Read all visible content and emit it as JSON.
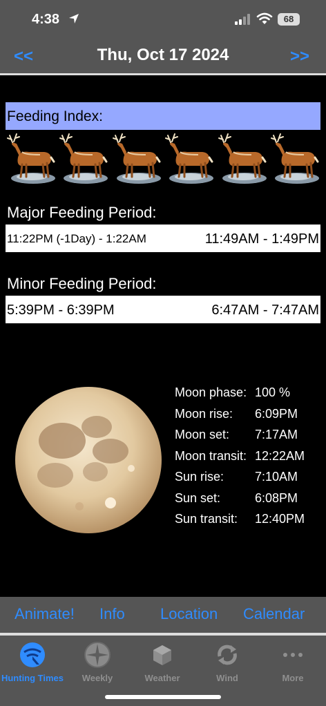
{
  "status_bar": {
    "time": "4:38",
    "battery": "68"
  },
  "header": {
    "prev": "<<",
    "date": "Thu, Oct 17 2024",
    "next": ">>"
  },
  "feeding_index": {
    "label": "Feeding Index:",
    "deer_count": 6
  },
  "major": {
    "label": "Major Feeding Period:",
    "left": "11:22PM (-1Day) - 1:22AM",
    "right": "11:49AM - 1:49PM"
  },
  "minor": {
    "label": "Minor Feeding Period:",
    "left": "5:39PM - 6:39PM",
    "right": "6:47AM - 7:47AM"
  },
  "astro": [
    {
      "key": "Moon phase:",
      "value": "100 %"
    },
    {
      "key": "Moon rise:",
      "value": "6:09PM"
    },
    {
      "key": "Moon set:",
      "value": "7:17AM"
    },
    {
      "key": "Moon transit:",
      "value": "12:22AM"
    },
    {
      "key": "Sun rise:",
      "value": "7:10AM"
    },
    {
      "key": "Sun set:",
      "value": "6:08PM"
    },
    {
      "key": "Sun transit:",
      "value": "12:40PM"
    }
  ],
  "actions": [
    "Animate!",
    "Info",
    "Location",
    "Calendar"
  ],
  "tabs": [
    {
      "label": "Hunting Times",
      "icon": "radar-icon",
      "active": true
    },
    {
      "label": "Weekly",
      "icon": "compass-icon",
      "active": false
    },
    {
      "label": "Weather",
      "icon": "cube-icon",
      "active": false
    },
    {
      "label": "Wind",
      "icon": "wind-icon",
      "active": false
    },
    {
      "label": "More",
      "icon": "more-icon",
      "active": false
    }
  ],
  "colors": {
    "accent": "#2f8cff",
    "feed_bar": "#95a8ff",
    "bar_bg": "#555555"
  }
}
